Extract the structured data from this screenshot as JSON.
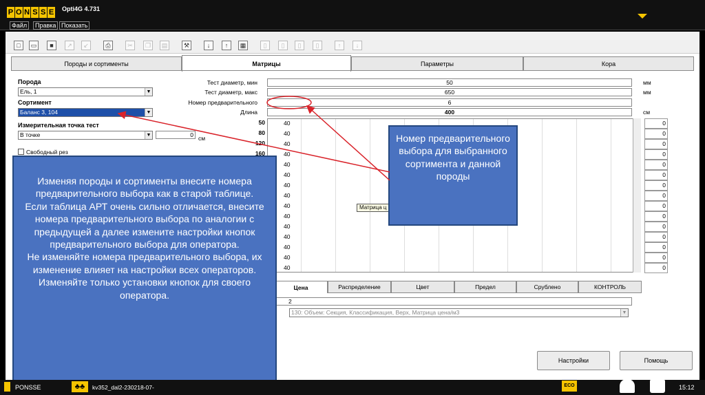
{
  "app": {
    "logo_letters": [
      "P",
      "O",
      "N",
      "S",
      "S",
      "E"
    ],
    "title": "Opti4G 4.731"
  },
  "menu": [
    "Файл",
    "Правка",
    "Показать"
  ],
  "tabs": [
    "Породы и сортименты",
    "Матрицы",
    "Параметры",
    "Кора"
  ],
  "active_tab": "Матрицы",
  "left": {
    "species_label": "Порода",
    "species_value": "Ель, 1",
    "assortment_label": "Сортимент",
    "assortment_value": "Баланс 3, 104",
    "measure_label": "Измерительная точка тест",
    "measure_value": "В точке",
    "measure_num": "0",
    "measure_unit": "см",
    "free_cut_label": "Свободный рез"
  },
  "params": [
    {
      "label": "Тест диаметр, мин",
      "value": "50",
      "unit": "мм"
    },
    {
      "label": "Тест диаметр, макс",
      "value": "650",
      "unit": "мм"
    },
    {
      "label": "Номер предварительного",
      "value": "6",
      "unit": ""
    },
    {
      "label": "Длина",
      "value": "400",
      "unit": "см"
    }
  ],
  "rows": [
    "50",
    "80",
    "120",
    "160"
  ],
  "cells": [
    "40",
    "40",
    "40",
    "40",
    "40",
    "40",
    "40",
    "40",
    "40",
    "40",
    "40",
    "40",
    "40",
    "40",
    "40"
  ],
  "right_cells": [
    "0",
    "0",
    "0",
    "0",
    "0",
    "0",
    "0",
    "0",
    "0",
    "0",
    "0",
    "0",
    "0",
    "0",
    "0"
  ],
  "tooltip": "Матрица ц",
  "bottom_tabs": [
    "Цена",
    "Распределение",
    "Цвет",
    "Предел",
    "Срублено",
    "КОНТРОЛЬ"
  ],
  "bottom_value": "2",
  "bottom_combo": "130: Объем: Секция, Классификация, Верх, Матрица цена/м3",
  "buttons": {
    "settings": "Настройки",
    "help": "Помощь"
  },
  "status": {
    "brand": "PONSSE",
    "file": "kv352_dal2-230218-07-",
    "eco": "ECO",
    "time": "15:12"
  },
  "callout_right": "Номер предварительного выбора для выбранного сортимента и данной породы",
  "callout_left": "Изменяя породы и сортименты внесите номера предварительного выбора как в старой таблице. Если таблица АРТ очень сильно отличается, внесите номера предварительного выбора по аналогии с предыдущей а далее измените настройки кнопок предварительного выбора для оператора.\nНе изменяйте номера предварительного выбора, их изменение влияет на настройки всех операторов. Изменяйте только установки кнопок для своего оператора.",
  "colors": {
    "brand_yellow": "#f5c400",
    "callout_blue": "#4a72c0",
    "annotation_red": "#d9232a"
  }
}
